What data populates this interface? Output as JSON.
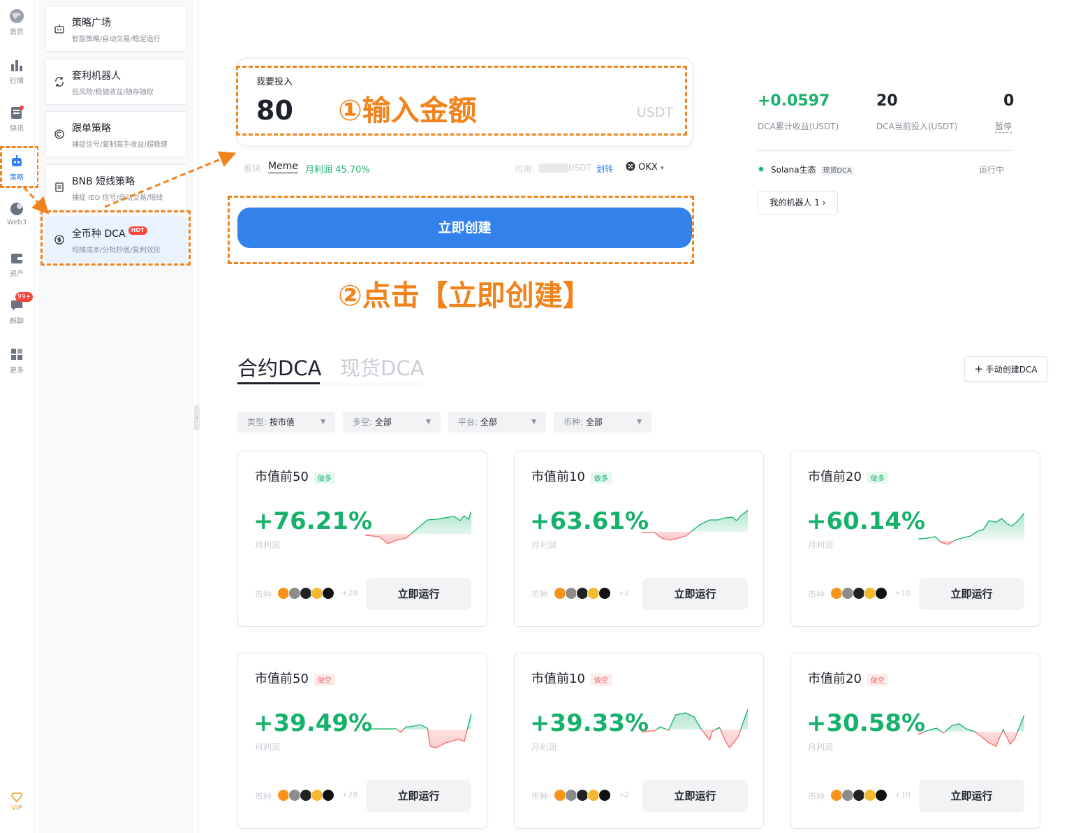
{
  "nav": {
    "items": [
      {
        "label": "首页",
        "icon": "globe-icon"
      },
      {
        "label": "行情",
        "icon": "bar-chart-icon"
      },
      {
        "label": "快讯",
        "icon": "news-icon"
      },
      {
        "label": "策略",
        "icon": "robot-icon"
      },
      {
        "label": "Web3",
        "icon": "web3-icon"
      },
      {
        "label": "资产",
        "icon": "wallet-icon"
      },
      {
        "label": "群聊",
        "icon": "chat-icon",
        "badge": "99+"
      },
      {
        "label": "更多",
        "icon": "grid-icon"
      }
    ],
    "vip": "VIP",
    "active_color": "#2f7ef5"
  },
  "strategies": [
    {
      "title": "策略广场",
      "subtitle": "智能策略/自动交易/稳定运行"
    },
    {
      "title": "套利机器人",
      "subtitle": "低风险/稳健收益/随存随取"
    },
    {
      "title": "跟单策略",
      "subtitle": "捕捉信号/复制高手收益/超稳健"
    },
    {
      "title": "BNB 短线策略",
      "subtitle": "捕捉 IEO 信号/自动交易/短线"
    },
    {
      "title": "全币种 DCA",
      "subtitle": "均摊成本/分批抄底/复利效应",
      "hot": "HOT"
    }
  ],
  "invest": {
    "label": "我要投入",
    "amount": "80",
    "unit": "USDT",
    "annotation1": "①输入金额",
    "sector_label": "板块",
    "sector_value": "Meme",
    "monthly_label": "月利润 45.70%",
    "available_label": "可用:",
    "available_unit": "USDT",
    "transfer": "划转",
    "exchange": "OKX"
  },
  "create_button": "立即创建",
  "annotation2": "②点击【立即创建】",
  "stats": {
    "profit_value": "+0.0597",
    "profit_label": "DCA累计收益(USDT)",
    "invest_value": "20",
    "invest_label": "DCA当前投入(USDT)",
    "paused_value": "0",
    "paused_label": "暂停",
    "bot_name": "Solana生态",
    "bot_tag": "现货DCA",
    "bot_status": "运行中",
    "my_bots": "我的机器人 1"
  },
  "tabs": {
    "contract": "合约DCA",
    "spot": "现货DCA"
  },
  "manual_create": "手动创建DCA",
  "filters": [
    {
      "label": "类型:",
      "value": "按市值"
    },
    {
      "label": "多空:",
      "value": "全部"
    },
    {
      "label": "平台:",
      "value": "全部"
    },
    {
      "label": "币种:",
      "value": "全部"
    }
  ],
  "cards": [
    {
      "title": "市值前50",
      "tag": "做多",
      "dir": "long",
      "pct": "+76.21%",
      "profit_label": "月利润",
      "coin_label": "币种",
      "more": "+28",
      "run": "立即运行"
    },
    {
      "title": "市值前10",
      "tag": "做多",
      "dir": "long",
      "pct": "+63.61%",
      "profit_label": "月利润",
      "coin_label": "币种",
      "more": "+2",
      "run": "立即运行"
    },
    {
      "title": "市值前20",
      "tag": "做多",
      "dir": "long",
      "pct": "+60.14%",
      "profit_label": "月利润",
      "coin_label": "币种",
      "more": "+10",
      "run": "立即运行"
    },
    {
      "title": "市值前50",
      "tag": "做空",
      "dir": "short",
      "pct": "+39.49%",
      "profit_label": "月利润",
      "coin_label": "币种",
      "more": "+28",
      "run": "立即运行"
    },
    {
      "title": "市值前10",
      "tag": "做空",
      "dir": "short",
      "pct": "+39.33%",
      "profit_label": "月利润",
      "coin_label": "币种",
      "more": "+2",
      "run": "立即运行"
    },
    {
      "title": "市值前20",
      "tag": "做空",
      "dir": "short",
      "pct": "+30.58%",
      "profit_label": "月利润",
      "coin_label": "币种",
      "more": "+10",
      "run": "立即运行"
    }
  ],
  "colors": {
    "accent": "#3381ea",
    "annotation": "#f0831c",
    "profit": "#16b16a",
    "loss": "#f36b6b"
  }
}
